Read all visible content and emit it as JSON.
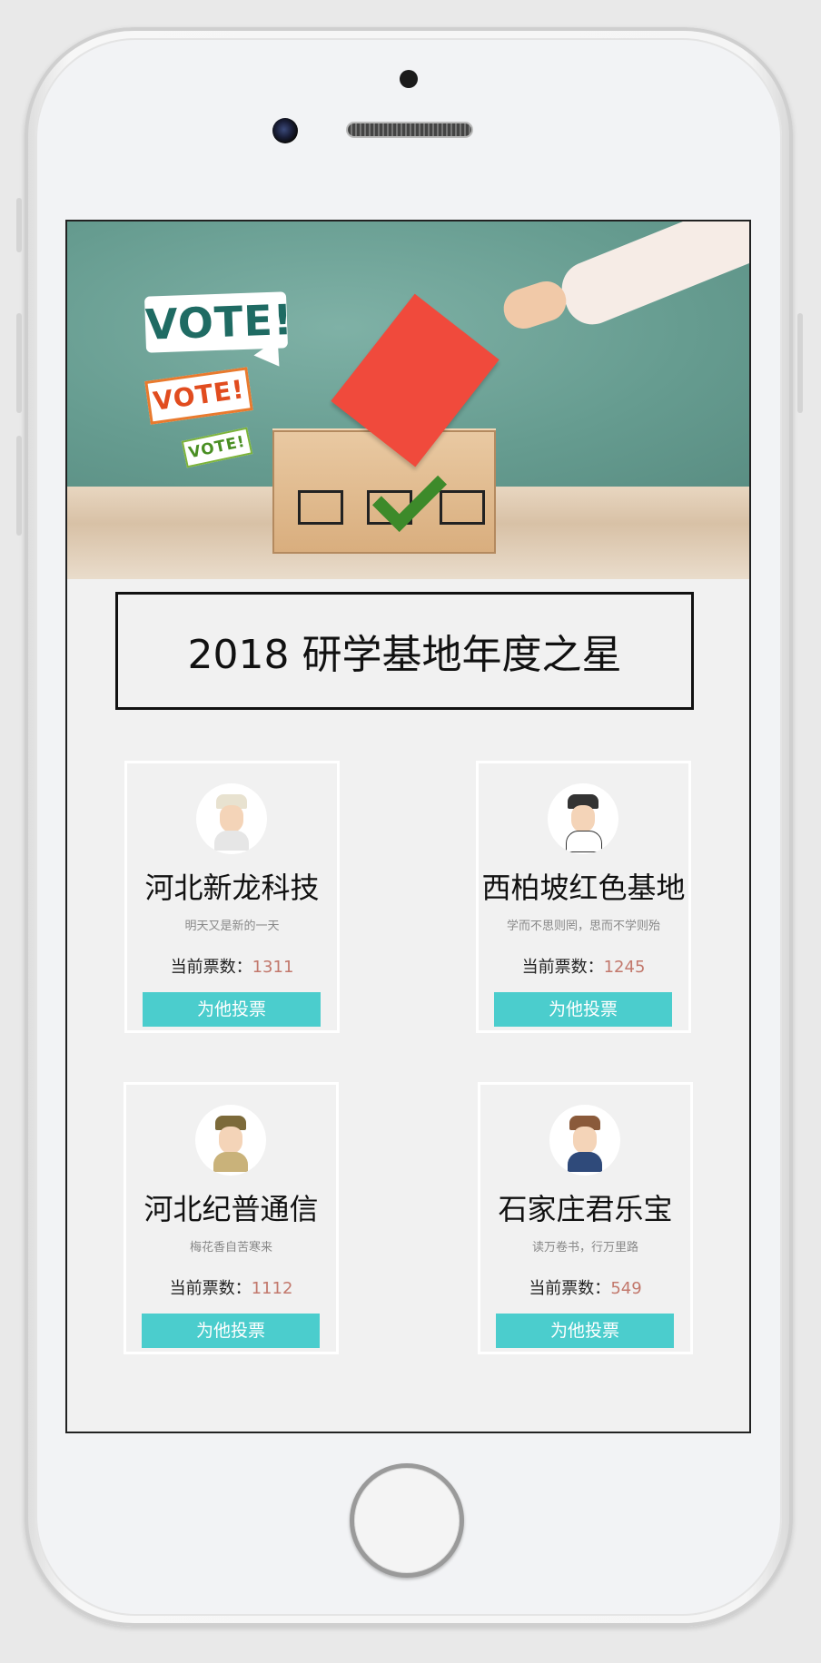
{
  "banner": {
    "bubbles": [
      "VOTE!",
      "VOTE!",
      "VOTE!"
    ]
  },
  "title": "2018 研学基地年度之星",
  "cards": [
    {
      "name": "河北新龙科技",
      "motto": "明天又是新的一天",
      "votes_label": "当前票数：",
      "votes": "1311",
      "button": "为他投票"
    },
    {
      "name": "西柏坡红色基地",
      "motto": "学而不思则罔，思而不学则殆",
      "votes_label": "当前票数：",
      "votes": "1245",
      "button": "为他投票"
    },
    {
      "name": "河北纪普通信",
      "motto": "梅花香自苦寒来",
      "votes_label": "当前票数：",
      "votes": "1112",
      "button": "为他投票"
    },
    {
      "name": "石家庄君乐宝",
      "motto": "读万卷书，行万里路",
      "votes_label": "当前票数：",
      "votes": "549",
      "button": "为他投票"
    }
  ],
  "colors": {
    "button": "#4bcdcd",
    "vote_count": "#c2786c",
    "ballot": "#f04a3c",
    "board": "#6fa59a"
  }
}
